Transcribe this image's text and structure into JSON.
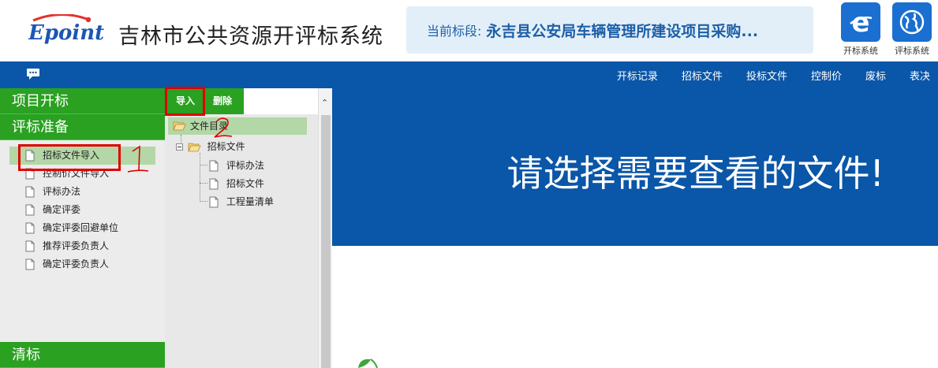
{
  "header": {
    "logo_text": "Epoint",
    "system_title": "吉林市公共资源开评标系统",
    "current_section_label": "当前标段:",
    "current_section_value": "永吉县公安局车辆管理所建设项目采购...",
    "system_buttons": [
      {
        "icon": "ie-e-icon",
        "label": "开标系统"
      },
      {
        "icon": "globe-icon",
        "label": "评标系统"
      }
    ]
  },
  "navbar": {
    "links": [
      "开标记录",
      "招标文件",
      "投标文件",
      "控制价",
      "废标",
      "表决"
    ]
  },
  "sidebar": {
    "sections": [
      "项目开标",
      "评标准备"
    ],
    "items": [
      "招标文件导入",
      "控制价文件导入",
      "评标办法",
      "确定评委",
      "确定评委回避单位",
      "推荐评委负责人",
      "确定评委负责人"
    ],
    "active_item": "招标文件导入",
    "bottom_section": "清标"
  },
  "tree": {
    "toolbar": {
      "import_label": "导入",
      "delete_label": "删除"
    },
    "root": "文件目录",
    "folder": "招标文件",
    "children": [
      "评标办法",
      "招标文件",
      "工程量清单"
    ]
  },
  "content": {
    "message": "请选择需要查看的文件!"
  },
  "annotations": [
    "1",
    "2"
  ],
  "colors": {
    "accent_green": "#2aa121",
    "nav_blue": "#0a56a8",
    "highlight_green": "#b3d7a6",
    "marker_red": "#e00000"
  }
}
